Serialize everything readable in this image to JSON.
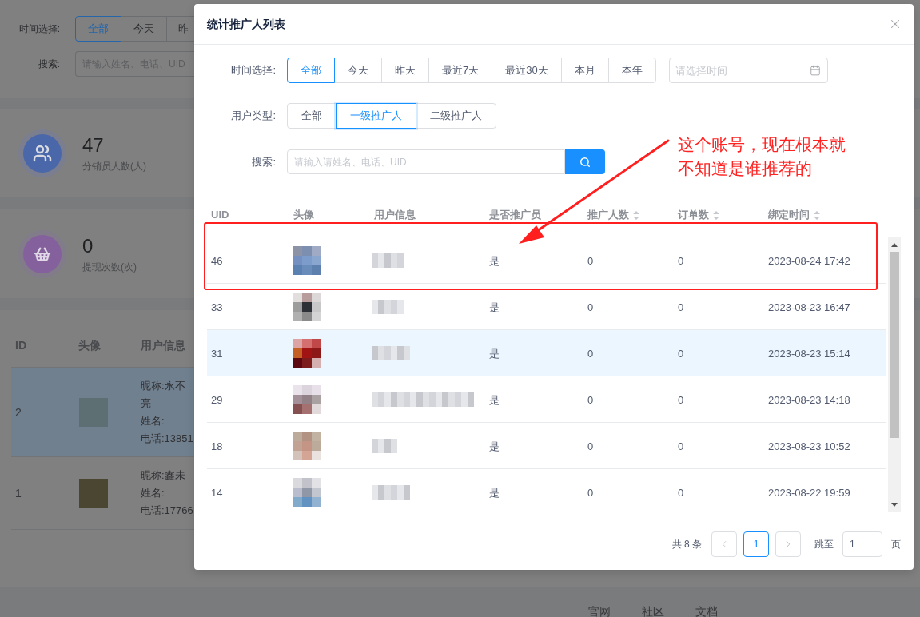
{
  "background": {
    "time_filter": {
      "label": "时间选择:",
      "options": [
        {
          "label": "全部",
          "selected": true
        },
        {
          "label": "今天",
          "selected": false
        },
        {
          "label": "昨",
          "selected": false
        }
      ]
    },
    "search": {
      "label": "搜索:",
      "placeholder": "请输入姓名、电话、UID"
    },
    "stats": [
      {
        "kind": "distributors",
        "value": "47",
        "label": "分销员人数(人)"
      },
      {
        "kind": "withdrawals",
        "value": "0",
        "label": "提现次数(次)"
      }
    ],
    "table": {
      "columns": [
        "ID",
        "头像",
        "用户信息"
      ],
      "rows": [
        {
          "id": "2",
          "highlighted": true,
          "info": [
            "昵称:永不",
            "亮",
            "姓名:",
            "电话:13851"
          ]
        },
        {
          "id": "1",
          "highlighted": false,
          "info": [
            "昵称:鑫未",
            "姓名:",
            "电话:17766"
          ]
        }
      ]
    },
    "footer_links": [
      "官网",
      "社区",
      "文档"
    ]
  },
  "dialog": {
    "title": "统计推广人列表",
    "time_filter": {
      "label": "时间选择:",
      "options": [
        {
          "label": "全部",
          "selected": true
        },
        {
          "label": "今天",
          "selected": false
        },
        {
          "label": "昨天",
          "selected": false
        },
        {
          "label": "最近7天",
          "selected": false
        },
        {
          "label": "最近30天",
          "selected": false
        },
        {
          "label": "本月",
          "selected": false
        },
        {
          "label": "本年",
          "selected": false
        }
      ],
      "date_placeholder": "请选择时间"
    },
    "user_type_filter": {
      "label": "用户类型:",
      "options": [
        {
          "label": "全部",
          "selected": false
        },
        {
          "label": "一级推广人",
          "selected": true
        },
        {
          "label": "二级推广人",
          "selected": false
        }
      ]
    },
    "search": {
      "label": "搜索:",
      "placeholder": "请输入请姓名、电话、UID"
    },
    "table": {
      "columns": [
        {
          "label": "UID",
          "sortable": false
        },
        {
          "label": "头像",
          "sortable": false
        },
        {
          "label": "用户信息",
          "sortable": false
        },
        {
          "label": "是否推广员",
          "sortable": false
        },
        {
          "label": "推广人数",
          "sortable": true
        },
        {
          "label": "订单数",
          "sortable": true
        },
        {
          "label": "绑定时间",
          "sortable": true
        }
      ],
      "rows": [
        {
          "uid": "46",
          "is_promoter": "是",
          "promoted_count": "0",
          "order_count": "0",
          "bind_time": "2023-08-24 17:42",
          "highlighted": false
        },
        {
          "uid": "33",
          "is_promoter": "是",
          "promoted_count": "0",
          "order_count": "0",
          "bind_time": "2023-08-23 16:47",
          "highlighted": false
        },
        {
          "uid": "31",
          "is_promoter": "是",
          "promoted_count": "0",
          "order_count": "0",
          "bind_time": "2023-08-23 15:14",
          "highlighted": true
        },
        {
          "uid": "29",
          "is_promoter": "是",
          "promoted_count": "0",
          "order_count": "0",
          "bind_time": "2023-08-23 14:18",
          "highlighted": false
        },
        {
          "uid": "18",
          "is_promoter": "是",
          "promoted_count": "0",
          "order_count": "0",
          "bind_time": "2023-08-23 10:52",
          "highlighted": false
        },
        {
          "uid": "14",
          "is_promoter": "是",
          "promoted_count": "0",
          "order_count": "0",
          "bind_time": "2023-08-22 19:59",
          "highlighted": false
        }
      ]
    },
    "pagination": {
      "total": "共 8 条",
      "pages": [
        {
          "label": "1",
          "selected": true
        }
      ],
      "jump_label": "跳至",
      "jump_value": "1",
      "unit": "页"
    }
  },
  "annotation": {
    "text": "这个账号，现在根本就不知道是谁推荐的"
  }
}
